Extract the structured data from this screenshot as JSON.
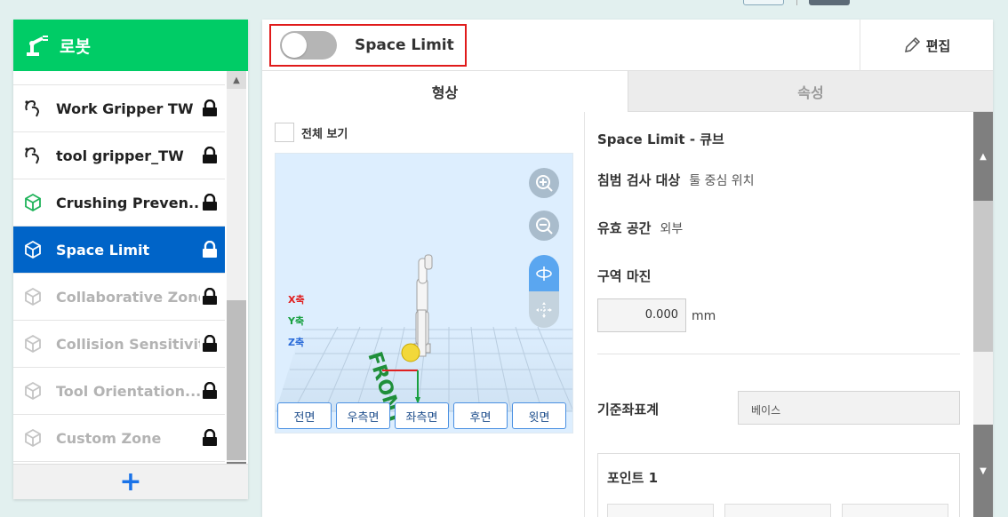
{
  "sidebar": {
    "title": "로봇",
    "items": [
      {
        "label": "Work Gripper TW",
        "icon": "gripper-icon",
        "state": "normal"
      },
      {
        "label": "tool gripper_TW",
        "icon": "gripper-icon",
        "state": "normal"
      },
      {
        "label": "Crushing Preven...",
        "icon": "cube-icon",
        "state": "normal"
      },
      {
        "label": "Space Limit",
        "icon": "cube-icon",
        "state": "active"
      },
      {
        "label": "Collaborative Zone",
        "icon": "cube-icon",
        "state": "disabled"
      },
      {
        "label": "Collision Sensitivit",
        "icon": "cube-icon",
        "state": "disabled"
      },
      {
        "label": "Tool Orientation...",
        "icon": "cube-icon",
        "state": "disabled"
      },
      {
        "label": "Custom Zone",
        "icon": "cube-icon",
        "state": "disabled"
      }
    ],
    "add_label": "+"
  },
  "header": {
    "title": "Space Limit",
    "toggle_on": false,
    "edit_label": "편집"
  },
  "tabs": [
    {
      "label": "형상",
      "active": true
    },
    {
      "label": "속성",
      "active": false
    }
  ],
  "viewer": {
    "full_view_label": "전체 보기",
    "axes": [
      "X축",
      "Y축",
      "Z축"
    ],
    "floor_text": "FRONT",
    "view_buttons": [
      "전면",
      "우측면",
      "좌측면",
      "후면",
      "윗면"
    ]
  },
  "props": {
    "title": "Space Limit - 큐브",
    "inspection_key": "침범 검사 대상",
    "inspection_val": "툴 중심 위치",
    "space_key": "유효 공간",
    "space_val": "외부",
    "margin_key": "구역 마진",
    "margin_val": "0.000",
    "margin_unit": "mm",
    "frame_key": "기준좌표계",
    "frame_val": "베이스",
    "point_title": "포인트 1"
  },
  "colors": {
    "accent_green": "#00cc66",
    "active_blue": "#0064c8",
    "highlight_red": "#e01a1a"
  }
}
